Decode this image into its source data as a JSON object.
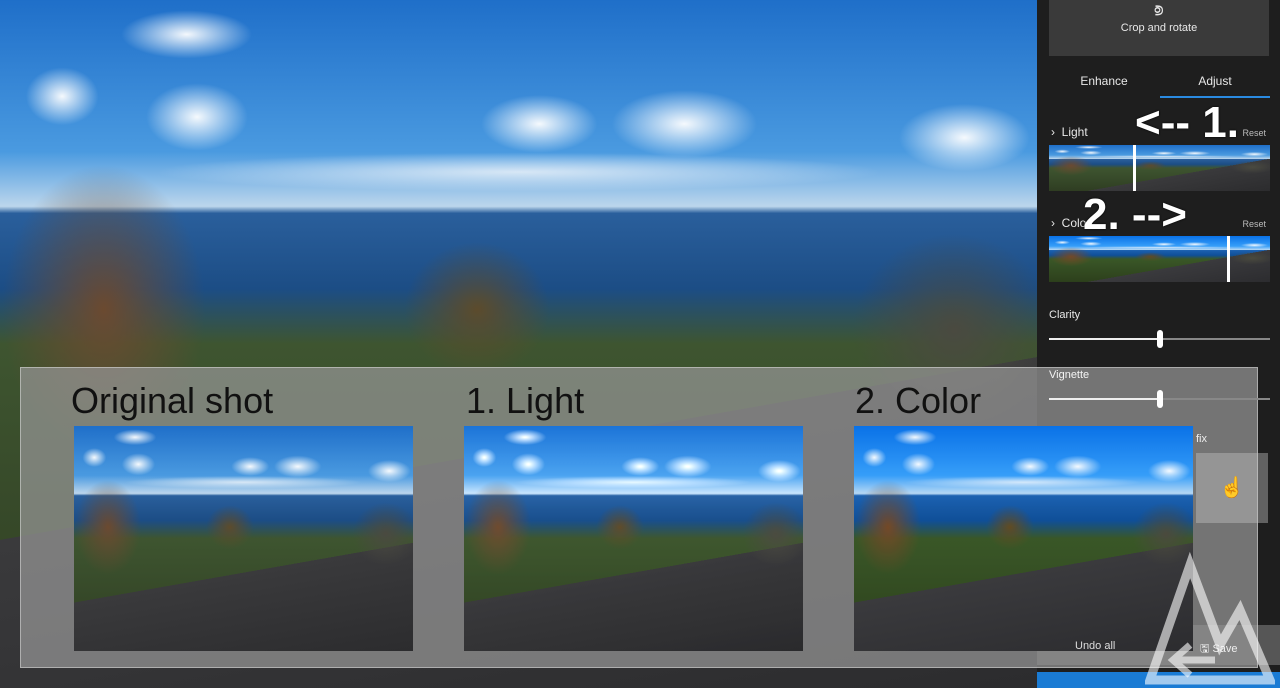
{
  "panel": {
    "crop_label": "Crop and rotate",
    "tabs": [
      {
        "label": "Enhance"
      },
      {
        "label": "Adjust"
      }
    ],
    "active_tab": "Adjust",
    "light": {
      "label": "Light",
      "reset": "Reset"
    },
    "color": {
      "label": "Color",
      "reset": "Reset"
    },
    "clarity": {
      "label": "Clarity",
      "value": 0.5
    },
    "vignette": {
      "label": "Vignette",
      "value": 0.5
    },
    "spot_fix_partial": "fix",
    "undo_label": "Undo all",
    "save_label": "Save",
    "accent": "#1a7bd4"
  },
  "annotations": {
    "one": "<-- 1.",
    "two": "2. -->"
  },
  "comparison": {
    "captions": [
      "Original shot",
      "1. Light",
      "2. Color"
    ]
  }
}
